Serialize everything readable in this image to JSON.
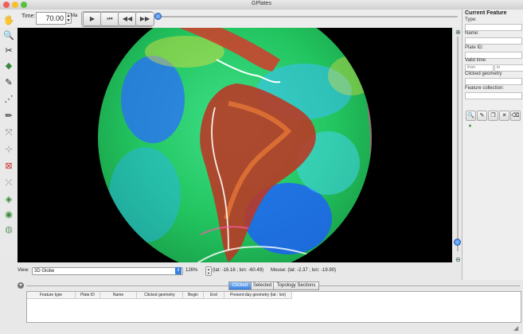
{
  "window": {
    "title": "GPlates"
  },
  "toolbar": {
    "time_label": "Time:",
    "time_value": "70.00",
    "time_unit": "Ma",
    "buttons": [
      "play",
      "rewind-to-start",
      "step-back",
      "step-forward"
    ]
  },
  "palette": {
    "tools": [
      "drag-globe-icon",
      "zoom-globe-icon",
      "measure-distance-icon",
      "click-geometry-icon",
      "digitise-polyline-icon",
      "digitise-multipoint-icon",
      "digitise-polygon-icon",
      "move-vertex-icon",
      "insert-vertex-icon",
      "delete-vertex-icon",
      "split-feature-icon",
      "build-topology-icon",
      "edit-topology-icon",
      "manipulate-pole-icon"
    ]
  },
  "view_bar": {
    "view_label": "View:",
    "view_value": "3D Globe",
    "zoom": "126%",
    "camera_coords": "(lat: -16.16 ; lon: -60.49)",
    "mouse_coords": "Mouse: (lat: -2.37 ; lon: -19.90)"
  },
  "right_panel": {
    "title": "Current Feature",
    "type_label": "Type:",
    "name_label": "Name:",
    "plate_label": "Plate ID:",
    "valid_label": "Valid time:",
    "from_placeholder": "from",
    "to_placeholder": "to",
    "clicked_geometry_label": "Clicked geometry",
    "feature_collection_label": "Feature collection:"
  },
  "bottom_panel": {
    "tabs": [
      "Clicked",
      "Selected",
      "Topology Sections"
    ],
    "active_tab": "Clicked",
    "columns": [
      "Feature type",
      "Plate ID",
      "Name",
      "Clicked geometry",
      "Begin",
      "End",
      "Present-day geometry (lat : lon)"
    ]
  },
  "colors": {
    "viewport_bg": "#000000",
    "ocean_green": "#2fd66a",
    "ocean_blue": "#1e5cff",
    "land_red": "#c8342a"
  }
}
